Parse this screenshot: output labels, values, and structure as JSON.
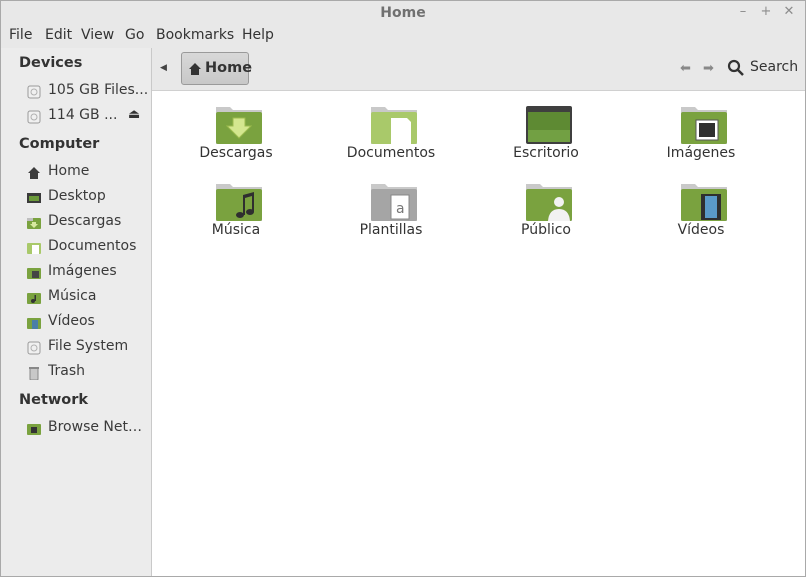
{
  "window": {
    "title": "Home"
  },
  "menu": [
    "File",
    "Edit",
    "View",
    "Go",
    "Bookmarks",
    "Help"
  ],
  "sidebar": {
    "devices_heading": "Devices",
    "devices": [
      {
        "label": "105 GB Files...",
        "icon": "drive-icon"
      },
      {
        "label": "114 GB ...",
        "icon": "drive-icon",
        "eject": "⏏"
      }
    ],
    "computer_heading": "Computer",
    "computer": [
      {
        "label": "Home",
        "icon": "home-icon"
      },
      {
        "label": "Desktop",
        "icon": "desktop-icon"
      },
      {
        "label": "Descargas",
        "icon": "downloads-folder-icon"
      },
      {
        "label": "Documentos",
        "icon": "documents-folder-icon"
      },
      {
        "label": "Imágenes",
        "icon": "pictures-folder-icon"
      },
      {
        "label": "Música",
        "icon": "music-folder-icon"
      },
      {
        "label": "Vídeos",
        "icon": "videos-folder-icon"
      },
      {
        "label": "File System",
        "icon": "drive-icon"
      },
      {
        "label": "Trash",
        "icon": "trash-icon"
      }
    ],
    "network_heading": "Network",
    "network": [
      {
        "label": "Browse Netw...",
        "icon": "network-folder-icon"
      }
    ]
  },
  "toolbar": {
    "breadcrumb": "Home",
    "search_label": "Search"
  },
  "folders": [
    {
      "label": "Descargas",
      "icon": "downloads"
    },
    {
      "label": "Documentos",
      "icon": "documents"
    },
    {
      "label": "Escritorio",
      "icon": "desktop"
    },
    {
      "label": "Imágenes",
      "icon": "pictures"
    },
    {
      "label": "Música",
      "icon": "music"
    },
    {
      "label": "Plantillas",
      "icon": "templates"
    },
    {
      "label": "Público",
      "icon": "public"
    },
    {
      "label": "Vídeos",
      "icon": "videos"
    }
  ],
  "colors": {
    "folder_green": "#7aa23f",
    "folder_light": "#a9c96a"
  }
}
